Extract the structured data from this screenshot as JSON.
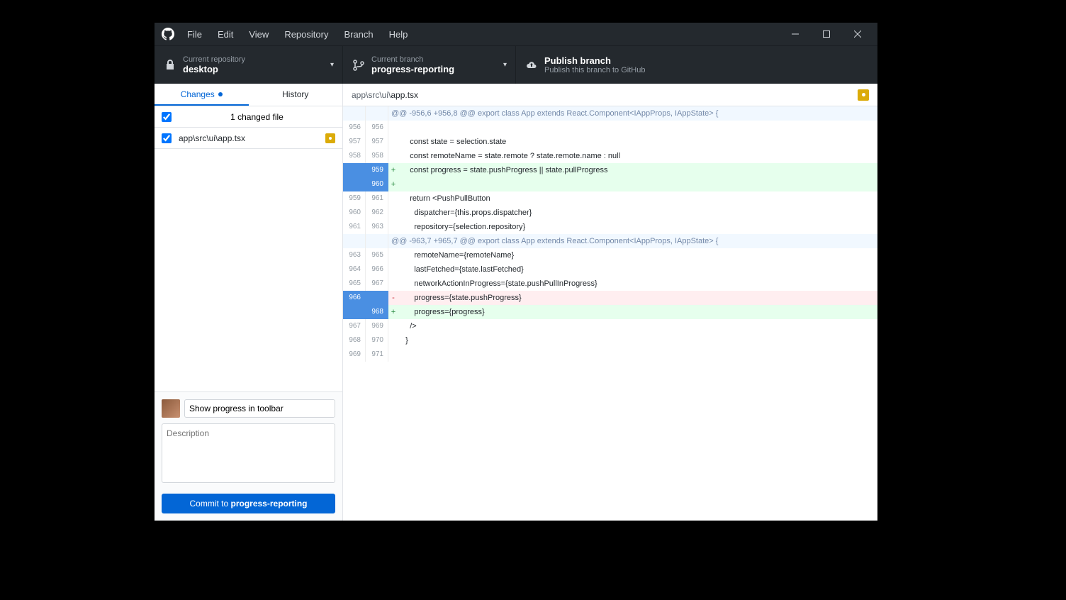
{
  "menus": [
    "File",
    "Edit",
    "View",
    "Repository",
    "Branch",
    "Help"
  ],
  "toolbar": {
    "repo": {
      "label": "Current repository",
      "value": "desktop"
    },
    "branch": {
      "label": "Current branch",
      "value": "progress-reporting"
    },
    "publish": {
      "label": "Publish branch",
      "sub": "Publish this branch to GitHub"
    }
  },
  "tabs": {
    "changes": "Changes",
    "history": "History"
  },
  "changes": {
    "header": "1 changed file",
    "files": [
      {
        "path": "app\\src\\ui\\app.tsx"
      }
    ]
  },
  "commit": {
    "summary": "Show progress in toolbar",
    "desc_placeholder": "Description",
    "button_prefix": "Commit to ",
    "button_branch": "progress-reporting"
  },
  "diff": {
    "pathPrefix": "app\\src\\ui\\",
    "pathFile": "app.tsx",
    "lines": [
      {
        "type": "hunk",
        "o": "",
        "n": "",
        "m": "",
        "t": "@@ -956,6 +956,8 @@ export class App extends React.Component<IAppProps, IAppState> {"
      },
      {
        "type": "ctx",
        "o": "956",
        "n": "956",
        "m": "",
        "t": ""
      },
      {
        "type": "ctx",
        "o": "957",
        "n": "957",
        "m": "",
        "t": "    const state = selection.state"
      },
      {
        "type": "ctx",
        "o": "958",
        "n": "958",
        "m": "",
        "t": "    const remoteName = state.remote ? state.remote.name : null"
      },
      {
        "type": "add",
        "o": "",
        "n": "959",
        "m": "+",
        "t": "    const progress = state.pushProgress || state.pullProgress",
        "hlO": true,
        "hlN": true
      },
      {
        "type": "add",
        "o": "",
        "n": "960",
        "m": "+",
        "t": "",
        "hlO": true,
        "hlN": true
      },
      {
        "type": "ctx",
        "o": "959",
        "n": "961",
        "m": "",
        "t": "    return <PushPullButton"
      },
      {
        "type": "ctx",
        "o": "960",
        "n": "962",
        "m": "",
        "t": "      dispatcher={this.props.dispatcher}"
      },
      {
        "type": "ctx",
        "o": "961",
        "n": "963",
        "m": "",
        "t": "      repository={selection.repository}"
      },
      {
        "type": "hunk",
        "o": "",
        "n": "",
        "m": "",
        "t": "@@ -963,7 +965,7 @@ export class App extends React.Component<IAppProps, IAppState> {"
      },
      {
        "type": "ctx",
        "o": "963",
        "n": "965",
        "m": "",
        "t": "      remoteName={remoteName}"
      },
      {
        "type": "ctx",
        "o": "964",
        "n": "966",
        "m": "",
        "t": "      lastFetched={state.lastFetched}"
      },
      {
        "type": "ctx",
        "o": "965",
        "n": "967",
        "m": "",
        "t": "      networkActionInProgress={state.pushPullInProgress}"
      },
      {
        "type": "del",
        "o": "966",
        "n": "",
        "m": "-",
        "t": "      progress={state.pushProgress}",
        "hlO": true,
        "hlN": true
      },
      {
        "type": "add",
        "o": "",
        "n": "968",
        "m": "+",
        "t": "      progress={progress}",
        "hlO": true,
        "hlN": true
      },
      {
        "type": "ctx",
        "o": "967",
        "n": "969",
        "m": "",
        "t": "    />"
      },
      {
        "type": "ctx",
        "o": "968",
        "n": "970",
        "m": "",
        "t": "  }"
      },
      {
        "type": "ctx",
        "o": "969",
        "n": "971",
        "m": "",
        "t": ""
      }
    ]
  }
}
